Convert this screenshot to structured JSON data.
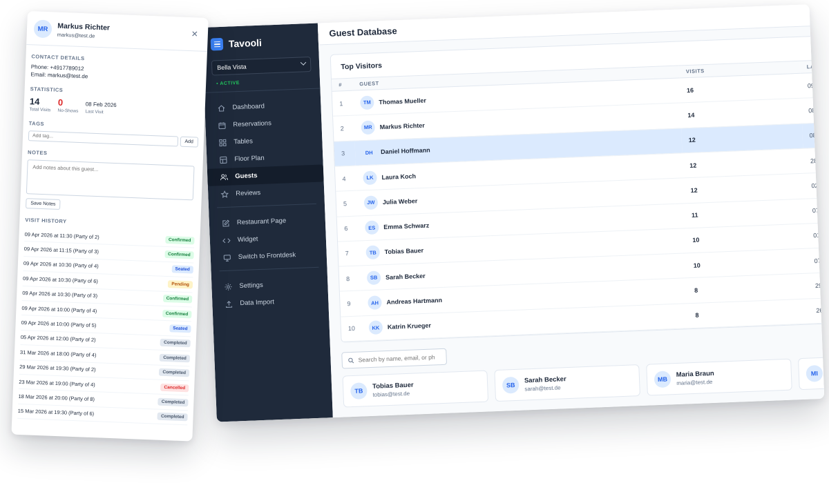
{
  "app": {
    "name": "Tavooli",
    "restaurant": "Bella Vista",
    "status": "• ACTIVE"
  },
  "nav": [
    {
      "label": "Dashboard",
      "icon": "home-icon"
    },
    {
      "label": "Reservations",
      "icon": "calendar-icon"
    },
    {
      "label": "Tables",
      "icon": "grid-icon"
    },
    {
      "label": "Floor Plan",
      "icon": "layout-icon"
    },
    {
      "label": "Guests",
      "icon": "users-icon"
    },
    {
      "label": "Reviews",
      "icon": "star-icon"
    },
    {
      "label": "Restaurant Page",
      "icon": "edit-icon"
    },
    {
      "label": "Widget",
      "icon": "code-icon"
    },
    {
      "label": "Switch to Frontdesk",
      "icon": "monitor-icon"
    },
    {
      "label": "Settings",
      "icon": "gear-icon"
    },
    {
      "label": "Data Import",
      "icon": "upload-icon"
    }
  ],
  "page": {
    "title": "Guest Database"
  },
  "top_visitors": {
    "title": "Top Visitors",
    "columns": {
      "rank": "#",
      "guest": "GUEST",
      "visits": "VISITS",
      "last": "LA"
    },
    "rows": [
      {
        "rank": "1",
        "initials": "TM",
        "name": "Thomas Mueller",
        "visits": "16",
        "last": "09"
      },
      {
        "rank": "2",
        "initials": "MR",
        "name": "Markus Richter",
        "visits": "14",
        "last": "08"
      },
      {
        "rank": "3",
        "initials": "DH",
        "name": "Daniel Hoffmann",
        "visits": "12",
        "last": "08"
      },
      {
        "rank": "4",
        "initials": "LK",
        "name": "Laura Koch",
        "visits": "12",
        "last": "28"
      },
      {
        "rank": "5",
        "initials": "JW",
        "name": "Julia Weber",
        "visits": "12",
        "last": "02"
      },
      {
        "rank": "6",
        "initials": "ES",
        "name": "Emma Schwarz",
        "visits": "11",
        "last": "07"
      },
      {
        "rank": "7",
        "initials": "TB",
        "name": "Tobias Bauer",
        "visits": "10",
        "last": "01"
      },
      {
        "rank": "8",
        "initials": "SB",
        "name": "Sarah Becker",
        "visits": "10",
        "last": "07"
      },
      {
        "rank": "9",
        "initials": "AH",
        "name": "Andreas Hartmann",
        "visits": "8",
        "last": "29"
      },
      {
        "rank": "10",
        "initials": "KK",
        "name": "Katrin Krueger",
        "visits": "8",
        "last": "26"
      }
    ]
  },
  "search": {
    "placeholder": "Search by name, email, or ph"
  },
  "guest_cards": [
    {
      "initials": "TB",
      "name": "Tobias Bauer",
      "email": "tobias@test.de"
    },
    {
      "initials": "SB",
      "name": "Sarah Becker",
      "email": "sarah@test.de"
    },
    {
      "initials": "MB",
      "name": "Maria Braun",
      "email": "maria@test.de"
    },
    {
      "initials": "MI",
      "name": "",
      "email": ""
    }
  ],
  "panel": {
    "initials": "MR",
    "name": "Markus Richter",
    "email": "markus@test.de",
    "contact_heading": "CONTACT DETAILS",
    "phone": "Phone: +4917789012",
    "email_line": "Email: markus@test.de",
    "stats_heading": "STATISTICS",
    "total_visits": "14",
    "total_visits_label": "Total Visits",
    "no_shows": "0",
    "no_shows_label": "No-Shows",
    "last_visit": "08 Feb 2026",
    "last_visit_label": "Last Visit",
    "tags_heading": "TAGS",
    "tag_placeholder": "Add tag...",
    "add_label": "Add",
    "notes_heading": "NOTES",
    "notes_placeholder": "Add notes about this guest...",
    "save_notes_label": "Save Notes",
    "history_heading": "VISIT HISTORY",
    "visits": [
      {
        "text": "09 Apr 2026 at 11:30 (Party of 2)",
        "status": "Confirmed",
        "kind": "confirmed"
      },
      {
        "text": "09 Apr 2026 at 11:15 (Party of 3)",
        "status": "Confirmed",
        "kind": "confirmed"
      },
      {
        "text": "09 Apr 2026 at 10:30 (Party of 4)",
        "status": "Seated",
        "kind": "seated"
      },
      {
        "text": "09 Apr 2026 at 10:30 (Party of 6)",
        "status": "Pending",
        "kind": "pending"
      },
      {
        "text": "09 Apr 2026 at 10:30 (Party of 3)",
        "status": "Confirmed",
        "kind": "confirmed"
      },
      {
        "text": "09 Apr 2026 at 10:00 (Party of 4)",
        "status": "Confirmed",
        "kind": "confirmed"
      },
      {
        "text": "09 Apr 2026 at 10:00 (Party of 5)",
        "status": "Seated",
        "kind": "seated"
      },
      {
        "text": "05 Apr 2026 at 12:00 (Party of 2)",
        "status": "Completed",
        "kind": "completed"
      },
      {
        "text": "31 Mar 2026 at 18:00 (Party of 4)",
        "status": "Completed",
        "kind": "completed"
      },
      {
        "text": "29 Mar 2026 at 19:30 (Party of 2)",
        "status": "Completed",
        "kind": "completed"
      },
      {
        "text": "23 Mar 2026 at 19:00 (Party of 4)",
        "status": "Cancelled",
        "kind": "cancelled"
      },
      {
        "text": "18 Mar 2026 at 20:00 (Party of 8)",
        "status": "Completed",
        "kind": "completed"
      },
      {
        "text": "15 Mar 2026 at 19:30 (Party of 6)",
        "status": "Completed",
        "kind": "completed"
      }
    ]
  }
}
